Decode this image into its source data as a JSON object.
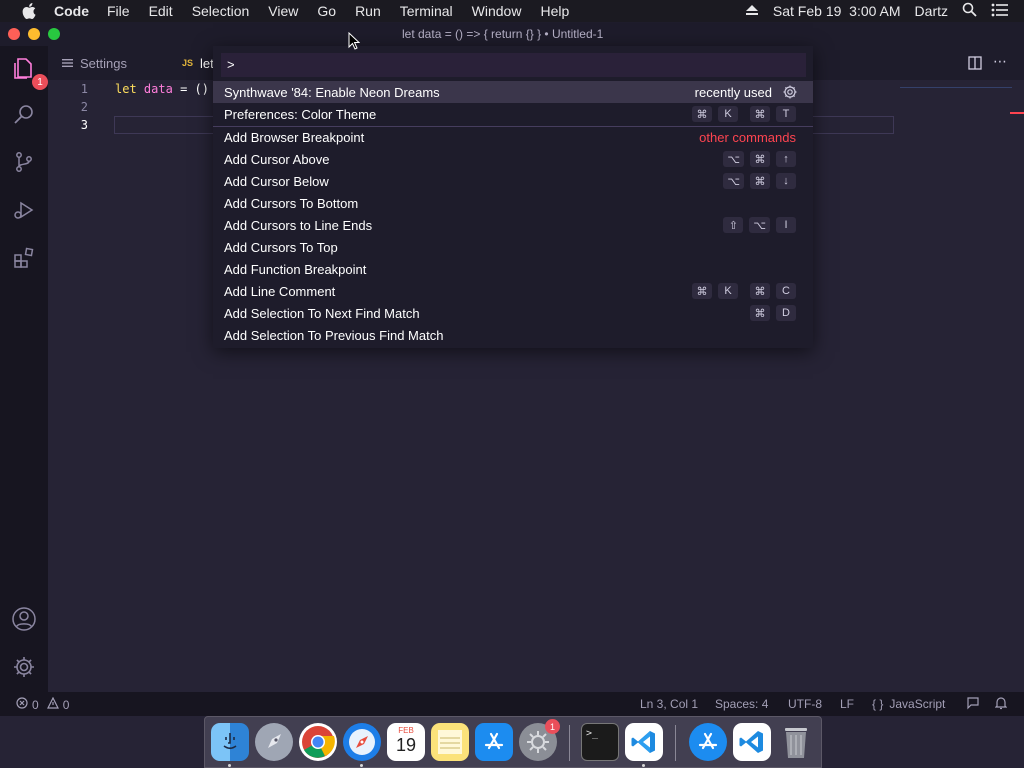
{
  "menubar": {
    "app_name": "Code",
    "items": [
      "File",
      "Edit",
      "Selection",
      "View",
      "Go",
      "Run",
      "Terminal",
      "Window",
      "Help"
    ],
    "datetime": "Sat Feb 19  3:00 AM",
    "user": "Dartz"
  },
  "window": {
    "title": "let data = () => { return {} } • Untitled-1"
  },
  "activity": {
    "explorer_badge": "1"
  },
  "tabs": [
    {
      "label": "Settings",
      "icon": "list-icon"
    },
    {
      "label": "let",
      "icon": "JS"
    }
  ],
  "editor": {
    "lines": [
      "1",
      "2",
      "3"
    ],
    "line1": {
      "kw": "let",
      "var": "data",
      "rest": "= ()"
    }
  },
  "palette": {
    "input_value": ">",
    "groups": {
      "recent": "recently used",
      "other": "other commands"
    },
    "items": [
      {
        "label": "Synthwave '84: Enable Neon Dreams",
        "keys": []
      },
      {
        "label": "Preferences: Color Theme",
        "keys": [
          "⌘",
          "K",
          "⌘",
          "T"
        ]
      },
      {
        "label": "Add Browser Breakpoint",
        "keys": []
      },
      {
        "label": "Add Cursor Above",
        "keys": [
          "⌥",
          "⌘",
          "↑"
        ]
      },
      {
        "label": "Add Cursor Below",
        "keys": [
          "⌥",
          "⌘",
          "↓"
        ]
      },
      {
        "label": "Add Cursors To Bottom",
        "keys": []
      },
      {
        "label": "Add Cursors to Line Ends",
        "keys": [
          "⇧",
          "⌥",
          "I"
        ]
      },
      {
        "label": "Add Cursors To Top",
        "keys": []
      },
      {
        "label": "Add Function Breakpoint",
        "keys": []
      },
      {
        "label": "Add Line Comment",
        "keys": [
          "⌘",
          "K",
          "⌘",
          "C"
        ]
      },
      {
        "label": "Add Selection To Next Find Match",
        "keys": [
          "⌘",
          "D"
        ]
      },
      {
        "label": "Add Selection To Previous Find Match",
        "keys": []
      }
    ]
  },
  "status": {
    "errors": "0",
    "warnings": "0",
    "position": "Ln 3, Col 1",
    "spaces": "Spaces: 4",
    "encoding": "UTF-8",
    "eol": "LF",
    "language": "JavaScript"
  },
  "dock": {
    "calendar_month": "FEB",
    "calendar_day": "19",
    "prefs_badge": "1"
  },
  "colors": {
    "background": "#262335",
    "panel": "#1e1c2b",
    "accent_pink": "#ff7edb",
    "accent_yellow": "#fede5d",
    "group_label_red": "#fe4450"
  }
}
